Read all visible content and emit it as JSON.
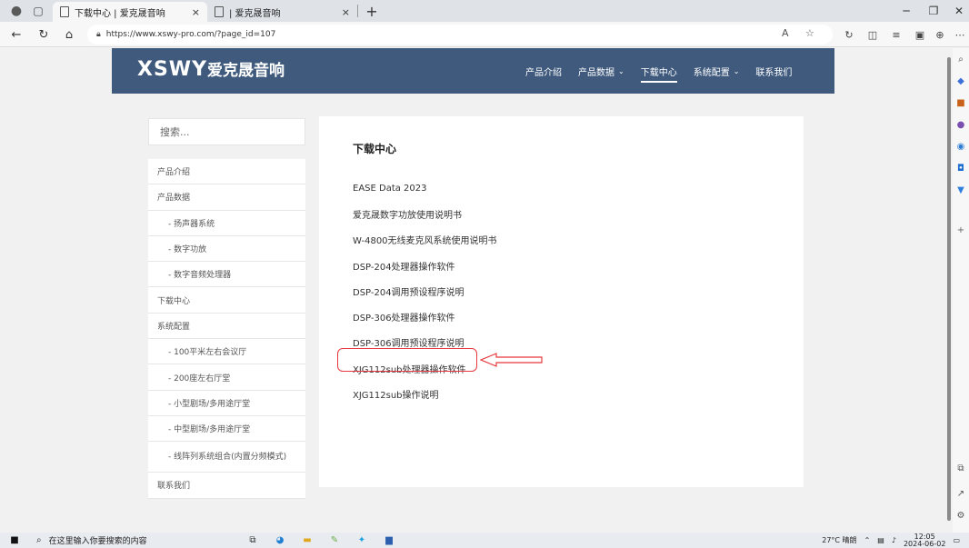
{
  "browser": {
    "tabs": [
      {
        "title": "下载中心 | 爱克晟音响",
        "active": true
      },
      {
        "title": "| 爱克晟音响",
        "active": false
      }
    ],
    "url": "https://www.xswy-pro.com/?page_id=107",
    "new_tab_glyph": "+"
  },
  "site": {
    "logo_latin": "XSWY",
    "logo_cn": "爱克晟音响",
    "nav": [
      {
        "label": "产品介绍",
        "has_dropdown": false,
        "active": false
      },
      {
        "label": "产品数据",
        "has_dropdown": true,
        "active": false
      },
      {
        "label": "下载中心",
        "has_dropdown": false,
        "active": true
      },
      {
        "label": "系统配置",
        "has_dropdown": true,
        "active": false
      },
      {
        "label": "联系我们",
        "has_dropdown": false,
        "active": false
      }
    ],
    "colors": {
      "header_bg": "#3f5a7d",
      "highlight": "#e8383d"
    }
  },
  "search": {
    "placeholder": "搜索..."
  },
  "sidebar": {
    "items": [
      {
        "label": "产品介绍",
        "sub": false
      },
      {
        "label": "产品数据",
        "sub": false
      },
      {
        "label": "- 扬声器系统",
        "sub": true
      },
      {
        "label": "- 数字功放",
        "sub": true
      },
      {
        "label": "- 数字音频处理器",
        "sub": true
      },
      {
        "label": "下载中心",
        "sub": false
      },
      {
        "label": "系统配置",
        "sub": false
      },
      {
        "label": "- 100平米左右会议厅",
        "sub": true
      },
      {
        "label": "- 200座左右厅堂",
        "sub": true
      },
      {
        "label": "- 小型剧场/多用途厅堂",
        "sub": true
      },
      {
        "label": "- 中型剧场/多用途厅堂",
        "sub": true
      },
      {
        "label": "- 线阵列系统组合(内置分频模式)",
        "sub": true
      },
      {
        "label": "联系我们",
        "sub": false
      }
    ]
  },
  "content": {
    "title": "下载中心",
    "downloads": [
      "EASE Data 2023",
      "爱克晟数字功放使用说明书",
      "W-4800无线麦克风系统使用说明书",
      "DSP-204处理器操作软件",
      "DSP-204调用预设程序说明",
      "DSP-306处理器操作软件",
      "DSP-306调用预设程序说明",
      "XJG112sub处理器操作软件",
      "XJG112sub操作说明"
    ]
  },
  "taskbar": {
    "search_placeholder": "在这里输入你要搜索的内容",
    "weather": "27°C 晴朗",
    "time": "12:05",
    "date": "2024-06-02"
  }
}
